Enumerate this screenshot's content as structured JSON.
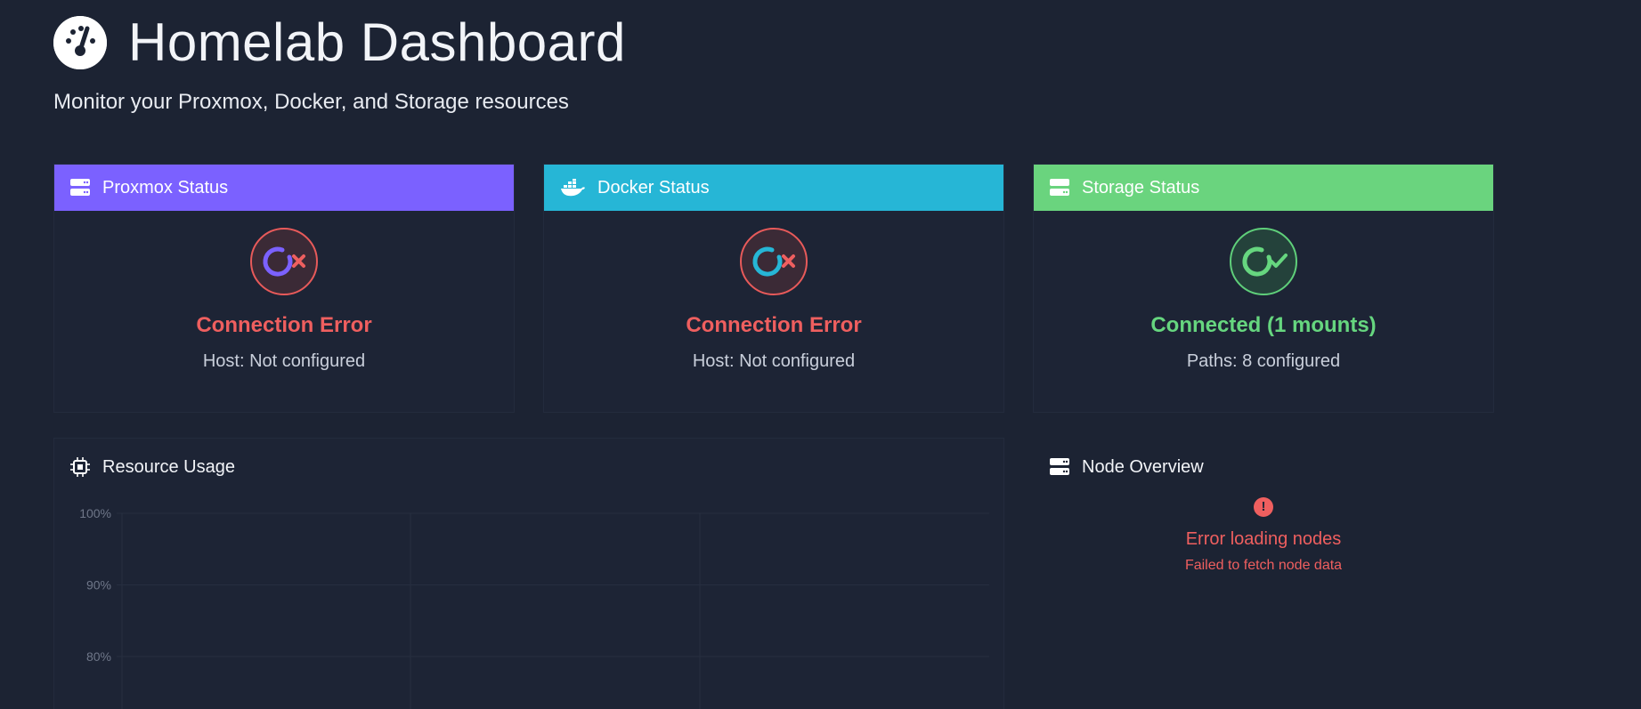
{
  "header": {
    "title": "Homelab Dashboard",
    "subtitle": "Monitor your Proxmox, Docker, and Storage resources",
    "logo_icon": "gauge-icon"
  },
  "cards": [
    {
      "title": "Proxmox Status",
      "icon": "server-icon",
      "color": "#7b61ff",
      "state": "error",
      "status": "Connection Error",
      "detail": "Host: Not configured"
    },
    {
      "title": "Docker Status",
      "icon": "docker-icon",
      "color": "#26b6d6",
      "state": "error",
      "status": "Connection Error",
      "detail": "Host: Not configured"
    },
    {
      "title": "Storage Status",
      "icon": "storage-icon",
      "color": "#6ad47e",
      "state": "ok",
      "status": "Connected (1 mounts)",
      "detail": "Paths: 8 configured"
    }
  ],
  "resource_usage": {
    "title": "Resource Usage",
    "icon": "cpu-icon"
  },
  "node_overview": {
    "title": "Node Overview",
    "icon": "server-icon",
    "error_title": "Error loading nodes",
    "error_detail": "Failed to fetch node data"
  },
  "chart_data": {
    "type": "line",
    "title": "",
    "xlabel": "",
    "ylabel": "",
    "ylim": [
      80,
      100
    ],
    "yticks": [
      "100%",
      "90%",
      "80%"
    ],
    "series": []
  }
}
